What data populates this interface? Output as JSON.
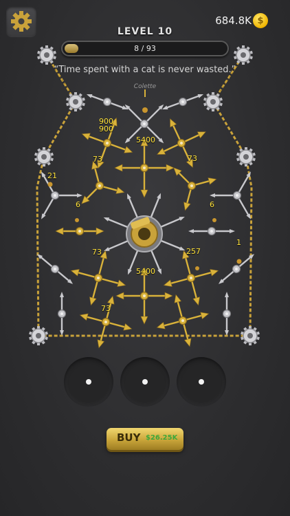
{
  "header": {
    "coins": "684.8K",
    "coin_symbol": "$",
    "level_label": "LEVEL 10",
    "progress_text": "8 / 93",
    "progress_fraction": 0.086
  },
  "quote": {
    "text": "“Time spent with a cat is never wasted.”",
    "author": "Colette"
  },
  "board_numbers": [
    "900",
    "900",
    "5400",
    "73",
    "73",
    "21",
    "6",
    "6",
    "73",
    "257",
    "1",
    "5400",
    "73"
  ],
  "footer": {
    "buy_label": "BUY",
    "buy_price": "$26.25K"
  },
  "colors": {
    "gold": "#d9b23a",
    "silver": "#c8c8cc",
    "background": "#2e2e30",
    "number": "#ffe23a",
    "price_green": "#3ea83a"
  }
}
